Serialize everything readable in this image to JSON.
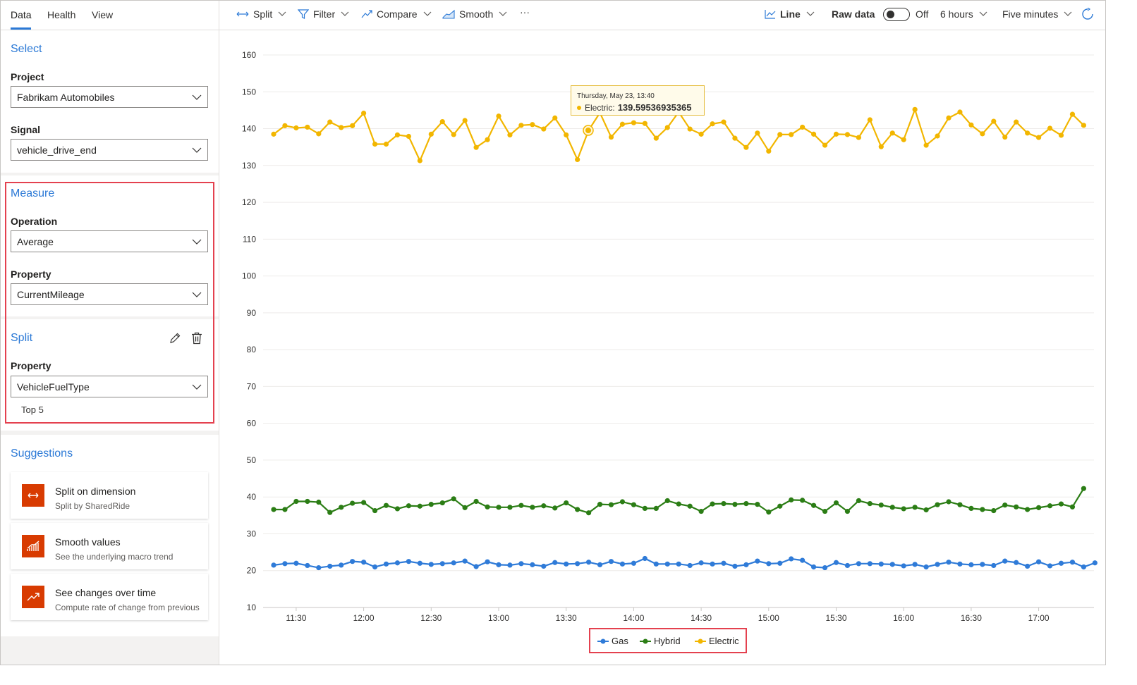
{
  "tabs": [
    "Data",
    "Health",
    "View"
  ],
  "select_section": {
    "title": "Select",
    "project_label": "Project",
    "project_value": "Fabrikam Automobiles",
    "signal_label": "Signal",
    "signal_value": "vehicle_drive_end"
  },
  "measure": {
    "title": "Measure",
    "operation_label": "Operation",
    "operation_value": "Average",
    "property_label": "Property",
    "property_value": "CurrentMileage"
  },
  "split": {
    "title": "Split",
    "property_label": "Property",
    "property_value": "VehicleFuelType",
    "top": "Top 5"
  },
  "suggestions": {
    "title": "Suggestions",
    "items": [
      {
        "title": "Split on dimension",
        "subtitle": "Split by SharedRide",
        "icon": "split-arrows-icon"
      },
      {
        "title": "Smooth values",
        "subtitle": "See the underlying macro trend",
        "icon": "smooth-chart-icon"
      },
      {
        "title": "See changes over time",
        "subtitle": "Compute rate of change from previous",
        "icon": "trend-up-icon"
      }
    ]
  },
  "toolbar": {
    "split": "Split",
    "filter": "Filter",
    "compare": "Compare",
    "smooth": "Smooth",
    "more": "···",
    "chart_type": "Line",
    "raw_data": "Raw data",
    "toggle_state": "Off",
    "range": "6 hours",
    "interval": "Five minutes"
  },
  "tooltip": {
    "date": "Thursday, May 23, 13:40",
    "series": "Electric:",
    "value": "139.59536935365"
  },
  "colors": {
    "accent": "#2b79d6",
    "gas": "#2f7bd8",
    "hybrid": "#2b7d15",
    "electric": "#f2b600",
    "highlight": "#e4414f"
  },
  "chart_data": {
    "type": "line",
    "y_ticks": [
      "10",
      "20",
      "30",
      "40",
      "50",
      "60",
      "70",
      "80",
      "90",
      "100",
      "110",
      "120",
      "130",
      "140",
      "150",
      "160"
    ],
    "ylim": [
      10,
      160
    ],
    "x_ticks": [
      "11:30",
      "12:00",
      "12:30",
      "13:00",
      "13:30",
      "14:00",
      "14:30",
      "15:00",
      "15:30",
      "16:00",
      "16:30",
      "17:00"
    ],
    "x_start_minutes": 680,
    "x_step_minutes": 5,
    "series": [
      {
        "name": "Gas",
        "color": "#2f7bd8",
        "values": [
          21.5,
          21.9,
          22.0,
          21.4,
          20.8,
          21.2,
          21.5,
          22.5,
          22.3,
          21.0,
          21.8,
          22.1,
          22.5,
          22.0,
          21.7,
          21.9,
          22.1,
          22.6,
          21.1,
          22.4,
          21.6,
          21.5,
          21.9,
          21.6,
          21.2,
          22.2,
          21.8,
          21.9,
          22.3,
          21.6,
          22.5,
          21.8,
          22.0,
          23.3,
          21.8,
          21.8,
          21.8,
          21.4,
          22.1,
          21.8,
          22.0,
          21.2,
          21.6,
          22.6,
          21.9,
          22.0,
          23.2,
          22.8,
          21.0,
          20.8,
          22.2,
          21.4,
          21.9,
          21.9,
          21.8,
          21.7,
          21.3,
          21.7,
          21.0,
          21.7,
          22.3,
          21.8,
          21.6,
          21.7,
          21.4,
          22.6,
          22.2,
          21.2,
          22.4,
          21.3,
          22.0,
          22.3,
          21.0,
          22.1
        ]
      },
      {
        "name": "Hybrid",
        "color": "#2b7d15",
        "values": [
          36.6,
          36.6,
          38.8,
          38.8,
          38.6,
          35.8,
          37.2,
          38.3,
          38.5,
          36.3,
          37.7,
          36.8,
          37.6,
          37.5,
          38.0,
          38.4,
          39.5,
          37.1,
          38.8,
          37.3,
          37.2,
          37.2,
          37.7,
          37.2,
          37.6,
          37.0,
          38.4,
          36.6,
          35.7,
          38.0,
          37.9,
          38.7,
          37.9,
          36.9,
          36.9,
          39.0,
          38.1,
          37.5,
          36.1,
          38.1,
          38.2,
          38.0,
          38.2,
          38.0,
          35.9,
          37.5,
          39.2,
          39.1,
          37.7,
          36.1,
          38.4,
          36.1,
          39.0,
          38.2,
          37.8,
          37.2,
          36.8,
          37.2,
          36.5,
          37.9,
          38.7,
          37.9,
          36.9,
          36.6,
          36.3,
          37.8,
          37.3,
          36.6,
          37.1,
          37.6,
          38.1,
          37.3,
          42.3
        ]
      },
      {
        "name": "Electric",
        "color": "#f2b600",
        "values": [
          138.5,
          140.8,
          140.2,
          140.4,
          138.6,
          141.8,
          140.3,
          140.8,
          144.2,
          135.8,
          135.8,
          138.3,
          137.9,
          131.3,
          138.5,
          141.9,
          138.4,
          142.2,
          134.9,
          137.0,
          143.4,
          138.3,
          140.9,
          141.1,
          139.9,
          142.9,
          138.3,
          131.6,
          139.6,
          144.3,
          137.7,
          141.2,
          141.6,
          141.4,
          137.4,
          140.3,
          144.5,
          139.9,
          138.5,
          141.3,
          141.8,
          137.4,
          134.9,
          138.8,
          133.9,
          138.4,
          138.4,
          140.4,
          138.5,
          135.5,
          138.5,
          138.4,
          137.6,
          142.4,
          135.1,
          138.8,
          137.0,
          145.2,
          135.5,
          138.0,
          142.9,
          144.5,
          141.0,
          138.6,
          142.0,
          137.7,
          141.8,
          138.8,
          137.6,
          140.1,
          138.2,
          143.9,
          140.9
        ]
      }
    ],
    "legend": [
      "Gas",
      "Hybrid",
      "Electric"
    ],
    "legend_position": "bottom-center",
    "grid": true
  }
}
